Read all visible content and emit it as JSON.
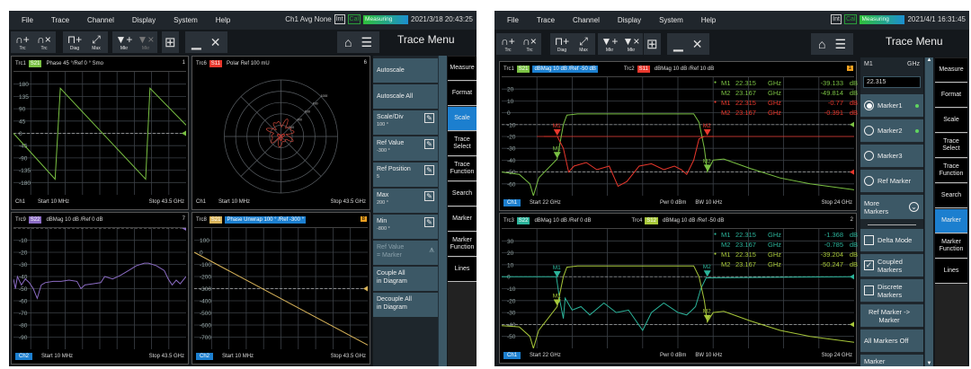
{
  "left": {
    "menu": [
      "File",
      "Trace",
      "Channel",
      "Display",
      "System",
      "Help"
    ],
    "status": {
      "channel": "Ch1 Avg None",
      "int": "Int",
      "cal": "Cal",
      "measuring": "Measuring",
      "datetime": "2021/3/18 20:43:25"
    },
    "toolbar": [
      {
        "glyph": "∩+",
        "label": "Trc",
        "icon": "add-trace-icon"
      },
      {
        "glyph": "∩×",
        "label": "Trc",
        "icon": "delete-trace-icon"
      },
      {
        "glyph": "⊓+",
        "label": "Diag",
        "icon": "add-diagram-icon"
      },
      {
        "glyph": "⤢",
        "label": "Max",
        "icon": "maximize-icon"
      },
      {
        "glyph": "▼+",
        "label": "Mkr",
        "icon": "add-marker-icon"
      },
      {
        "glyph": "▼×",
        "label": "Mkr",
        "icon": "delete-marker-icon"
      }
    ],
    "menu_title": "Trace Menu",
    "buttons": [
      {
        "label": "Autoscale"
      },
      {
        "label": "Autoscale All"
      },
      {
        "label": "Scale/Div",
        "value": "100 °"
      },
      {
        "label": "Ref Value",
        "value": "-300 °"
      },
      {
        "label": "Ref Position",
        "value": "5"
      },
      {
        "label": "Max",
        "value": "200 °"
      },
      {
        "label": "Min",
        "value": "-800 °"
      },
      {
        "label": "Ref Value",
        "value": "= Marker"
      },
      {
        "label": "Couple All",
        "value": "in Diagram"
      },
      {
        "label": "Decouple All",
        "value": "in Diagram"
      }
    ],
    "tabs": [
      "Measure",
      "Format",
      "Scale",
      "Trace Select",
      "Trace Function",
      "Search",
      "Marker",
      "Marker Function",
      "Lines"
    ],
    "selected_tab": "Scale"
  },
  "right": {
    "menu": [
      "File",
      "Trace",
      "Channel",
      "Display",
      "System",
      "Help"
    ],
    "status": {
      "int": "Int",
      "cal": "Cal",
      "measuring": "Measuring",
      "datetime": "2021/4/1 16:31:45"
    },
    "toolbar": [
      {
        "glyph": "∩+",
        "label": "Trc"
      },
      {
        "glyph": "∩×",
        "label": "Trc"
      },
      {
        "glyph": "⊓+",
        "label": "Diag"
      },
      {
        "glyph": "⤢",
        "label": "Max"
      },
      {
        "glyph": "▼+",
        "label": "Mkr"
      },
      {
        "glyph": "▼×",
        "label": "Mkr"
      }
    ],
    "menu_title": "Trace Menu",
    "marker_panel": {
      "title": "M1",
      "unit": "GHz",
      "value": "22.315",
      "markers": [
        "Marker1",
        "Marker2",
        "Marker3",
        "Ref Marker"
      ],
      "more": "More Markers",
      "delta": "Delta Mode",
      "coupled": "Coupled Markers",
      "discrete": "Discrete Markers",
      "ref_to_marker": "Ref Marker -> Marker",
      "all_off": "All Markers Off",
      "last": "Marker"
    },
    "tabs": [
      "Measure",
      "Format",
      "Scale",
      "Trace Select",
      "Trace Function",
      "Search",
      "Marker",
      "Marker Function",
      "Lines"
    ],
    "selected_tab": "Marker"
  },
  "colors": {
    "s21": "#7ac143",
    "s11": "#e8372c",
    "s22": "#2bb39a",
    "s12": "#a8c83a",
    "purple": "#8b6cc4",
    "gold": "#d9b45a",
    "accent": "#1c7fcf"
  },
  "chart_data": [
    {
      "type": "line",
      "traces": [
        {
          "name": "Trc1",
          "param": "S21",
          "format": "Phase 45 °/Ref 0 ° Smo",
          "color": "#7ac143",
          "points": [
            [
              0.01,
              0
            ],
            [
              10.5,
              -168
            ],
            [
              11.8,
              165
            ],
            [
              33.3,
              -168
            ],
            [
              34.4,
              165
            ],
            [
              43.5,
              30
            ]
          ]
        }
      ],
      "diagram": "1",
      "xlim": [
        0.01,
        43.5
      ],
      "ylim": [
        -225,
        225
      ],
      "yticks": [
        180,
        135,
        90,
        45,
        0,
        -45,
        -90,
        -135,
        -180
      ],
      "ref": [
        0
      ],
      "footer": {
        "channel": "Ch1",
        "start": "Start 10 MHz",
        "stop": "Stop 43.5 GHz"
      }
    },
    {
      "type": "polar",
      "traces": [
        {
          "name": "Trc6",
          "param": "S11",
          "format": "Polar Ref 100 mU",
          "color": "#e8372c"
        }
      ],
      "diagram": "6",
      "rings": [
        200,
        400,
        600,
        800,
        1000
      ],
      "footer": {
        "channel": "Ch1",
        "start": "Start 10 MHz",
        "stop": "Stop 43.5 GHz"
      }
    },
    {
      "type": "line",
      "traces": [
        {
          "name": "Trc9",
          "param": "S22",
          "format": "dBMag 10 dB /Ref 0 dB",
          "color": "#8b6cc4",
          "points": [
            [
              0,
              -42
            ],
            [
              0.5,
              -50
            ],
            [
              1,
              -40
            ],
            [
              2,
              -47
            ],
            [
              3,
              -42
            ],
            [
              4,
              -45
            ],
            [
              5,
              -50
            ],
            [
              6,
              -58
            ],
            [
              7,
              -47
            ],
            [
              8,
              -45
            ],
            [
              10,
              -44
            ],
            [
              12,
              -44
            ],
            [
              14,
              -43
            ],
            [
              16,
              -44
            ],
            [
              17,
              -50
            ],
            [
              18,
              -47
            ],
            [
              20,
              -46
            ],
            [
              22,
              -45
            ],
            [
              23,
              -40
            ],
            [
              25,
              -42
            ],
            [
              27,
              -39
            ],
            [
              29,
              -35
            ],
            [
              31,
              -31
            ],
            [
              33,
              -29
            ],
            [
              34,
              -29
            ],
            [
              36,
              -31
            ],
            [
              38,
              -35
            ],
            [
              39,
              -42
            ],
            [
              40,
              -47
            ],
            [
              41,
              -43
            ],
            [
              42,
              -46
            ],
            [
              43.5,
              -40
            ]
          ]
        }
      ],
      "diagram": "7",
      "xlim": [
        0.01,
        43.5
      ],
      "ylim": [
        -100,
        0
      ],
      "yticks": [
        -10,
        -20,
        -30,
        -40,
        -50,
        -60,
        -70,
        -80,
        -90
      ],
      "ref": [
        0
      ],
      "footer": {
        "channel": "Ch2",
        "start": "Start 10 MHz",
        "stop": "Stop 43.5 GHz"
      }
    },
    {
      "type": "line",
      "traces": [
        {
          "name": "Trc8",
          "param": "S21",
          "format": "Phase Unwrap 100 ° /Ref -300 °",
          "color": "#d9b45a",
          "points": [
            [
              0.01,
              0
            ],
            [
              43.5,
              -765
            ]
          ]
        }
      ],
      "diagram": "8",
      "xlim": [
        0.01,
        43.5
      ],
      "ylim": [
        -800,
        200
      ],
      "yticks": [
        100,
        0,
        -100,
        -200,
        -300,
        -400,
        -500,
        -600,
        -700
      ],
      "ref": [
        -300
      ],
      "footer": {
        "channel": "Ch2",
        "start": "Start 10 MHz",
        "stop": "Stop 43.5 GHz"
      }
    },
    {
      "type": "line",
      "traces": [
        {
          "name": "Trc1",
          "param": "S21",
          "format": "dBMag 10 dB /Ref -50 dB",
          "color": "#7ac143",
          "points": [
            [
              22,
              -50
            ],
            [
              22.1,
              -52
            ],
            [
              22.16,
              -60
            ],
            [
              22.18,
              -70
            ],
            [
              22.21,
              -55
            ],
            [
              22.315,
              -39
            ],
            [
              22.35,
              -10
            ],
            [
              22.37,
              -2
            ],
            [
              22.43,
              -1
            ],
            [
              23.09,
              -1
            ],
            [
              23.12,
              -8
            ],
            [
              23.15,
              -30
            ],
            [
              23.167,
              -49.8
            ],
            [
              23.2,
              -40
            ],
            [
              23.26,
              -39
            ],
            [
              23.41,
              -47
            ],
            [
              23.58,
              -55
            ],
            [
              23.75,
              -60
            ],
            [
              24,
              -65
            ]
          ],
          "markers": [
            {
              "label": "M1",
              "x": 22.315,
              "y": -39.133
            },
            {
              "label": "M2",
              "x": 23.167,
              "y": -49.814
            }
          ]
        },
        {
          "name": "Trc2",
          "param": "S11",
          "format": "dBMag 10 dB /Ref 10 dB",
          "color": "#e8372c",
          "points": [
            [
              22.24,
              -20
            ],
            [
              22.316,
              -20
            ],
            [
              22.35,
              -30
            ],
            [
              22.38,
              -50
            ],
            [
              22.41,
              -45
            ],
            [
              22.48,
              -42
            ],
            [
              22.54,
              -48
            ],
            [
              22.61,
              -45
            ],
            [
              22.66,
              -62
            ],
            [
              22.71,
              -58
            ],
            [
              22.78,
              -45
            ],
            [
              22.85,
              -43
            ],
            [
              22.92,
              -48
            ],
            [
              22.98,
              -45
            ],
            [
              23.02,
              -48
            ],
            [
              23.05,
              -52
            ],
            [
              23.09,
              -40
            ],
            [
              23.12,
              -22
            ],
            [
              23.15,
              -20
            ],
            [
              23.2,
              -20
            ]
          ],
          "markers": [
            {
              "label": "M1",
              "x": 22.315,
              "y": -20
            },
            {
              "label": "M2",
              "x": 23.167,
              "y": -20
            }
          ]
        }
      ],
      "diagram": "1",
      "xlim": [
        22,
        24
      ],
      "ylim": [
        -70,
        30
      ],
      "yticks": [
        20,
        10,
        0,
        -10,
        -20,
        -30,
        -40,
        -50,
        -60
      ],
      "ref": [
        -10,
        -50
      ],
      "hline": -20,
      "marker_table": [
        [
          "M1",
          "22.315",
          "GHz",
          "-39.133",
          "dB"
        ],
        [
          "M2",
          "23.167",
          "GHz",
          "-49.814",
          "dB"
        ],
        [
          "M1",
          "22.315",
          "GHz",
          "-0.77",
          "dB"
        ],
        [
          "M2",
          "23.167",
          "GHz",
          "-0.391",
          "dB"
        ]
      ],
      "footer": {
        "channel": "Ch1",
        "start": "Start 22 GHz",
        "power": "Pwr 0 dBm",
        "bw": "BW 10 kHz",
        "stop": "Stop 24 GHz"
      }
    },
    {
      "type": "line",
      "traces": [
        {
          "name": "Trc3",
          "param": "S22",
          "format": "dBMag 10 dB /Ref 0 dB",
          "color": "#2bb39a",
          "points": [
            [
              22,
              0
            ],
            [
              22.31,
              0
            ],
            [
              22.33,
              -20
            ],
            [
              22.35,
              -35
            ],
            [
              22.36,
              -18
            ],
            [
              22.4,
              -28
            ],
            [
              22.45,
              -25
            ],
            [
              22.5,
              -32
            ],
            [
              22.58,
              -22
            ],
            [
              22.65,
              -30
            ],
            [
              22.72,
              -28
            ],
            [
              22.8,
              -45
            ],
            [
              22.85,
              -30
            ],
            [
              22.92,
              -22
            ],
            [
              23,
              -30
            ],
            [
              23.05,
              -32
            ],
            [
              23.08,
              -28
            ],
            [
              23.1,
              -25
            ],
            [
              23.13,
              -10
            ],
            [
              23.16,
              -1
            ],
            [
              24,
              0
            ]
          ],
          "markers": [
            {
              "label": "M1",
              "x": 22.315,
              "y": -1.368
            },
            {
              "label": "M2",
              "x": 23.167,
              "y": -0.785
            }
          ]
        },
        {
          "name": "Trc4",
          "param": "S12",
          "format": "dBMag 10 dB /Ref -50 dB",
          "color": "#a8c83a",
          "points": [
            [
              22,
              -41
            ],
            [
              22.1,
              -42
            ],
            [
              22.16,
              -50
            ],
            [
              22.18,
              -60
            ],
            [
              22.21,
              -45
            ],
            [
              22.315,
              -25
            ],
            [
              22.35,
              0
            ],
            [
              22.37,
              8
            ],
            [
              22.43,
              9
            ],
            [
              23.09,
              9
            ],
            [
              23.12,
              0
            ],
            [
              23.15,
              -20
            ],
            [
              23.167,
              -38
            ],
            [
              23.2,
              -30
            ],
            [
              23.26,
              -29
            ],
            [
              23.41,
              -37
            ],
            [
              23.58,
              -45
            ],
            [
              23.75,
              -50
            ],
            [
              24,
              -55
            ]
          ],
          "markers": [
            {
              "label": "M1",
              "x": 22.315,
              "y": -25
            },
            {
              "label": "M2",
              "x": 23.167,
              "y": -38
            }
          ]
        }
      ],
      "diagram": "2",
      "xlim": [
        22,
        24
      ],
      "ylim": [
        -60,
        40
      ],
      "yticks": [
        30,
        20,
        10,
        0,
        -10,
        -20,
        -30,
        -40,
        -50
      ],
      "ref": [
        0,
        -40
      ],
      "marker_table": [
        [
          "M1",
          "22.315",
          "GHz",
          "-1.368",
          "dB"
        ],
        [
          "M2",
          "23.167",
          "GHz",
          "-0.785",
          "dB"
        ],
        [
          "M1",
          "22.315",
          "GHz",
          "-39.204",
          "dB"
        ],
        [
          "M2",
          "23.167",
          "GHz",
          "-50.247",
          "dB"
        ]
      ],
      "footer": {
        "channel": "Ch1",
        "start": "Start 22 GHz",
        "power": "Pwr 0 dBm",
        "bw": "BW 10 kHz",
        "stop": "Stop 24 GHz"
      }
    }
  ]
}
